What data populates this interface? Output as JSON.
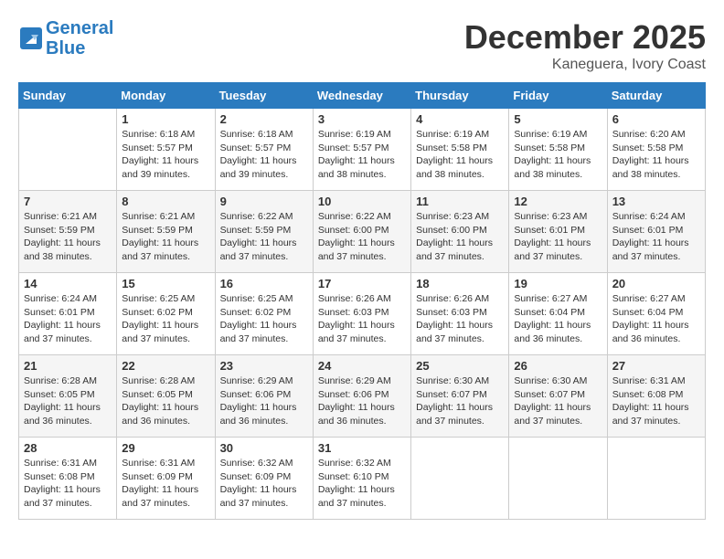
{
  "header": {
    "logo_line1": "General",
    "logo_line2": "Blue",
    "month": "December 2025",
    "location": "Kaneguera, Ivory Coast"
  },
  "weekdays": [
    "Sunday",
    "Monday",
    "Tuesday",
    "Wednesday",
    "Thursday",
    "Friday",
    "Saturday"
  ],
  "weeks": [
    [
      {
        "day": "",
        "sunrise": "",
        "sunset": "",
        "daylight": ""
      },
      {
        "day": "1",
        "sunrise": "Sunrise: 6:18 AM",
        "sunset": "Sunset: 5:57 PM",
        "daylight": "Daylight: 11 hours and 39 minutes."
      },
      {
        "day": "2",
        "sunrise": "Sunrise: 6:18 AM",
        "sunset": "Sunset: 5:57 PM",
        "daylight": "Daylight: 11 hours and 39 minutes."
      },
      {
        "day": "3",
        "sunrise": "Sunrise: 6:19 AM",
        "sunset": "Sunset: 5:57 PM",
        "daylight": "Daylight: 11 hours and 38 minutes."
      },
      {
        "day": "4",
        "sunrise": "Sunrise: 6:19 AM",
        "sunset": "Sunset: 5:58 PM",
        "daylight": "Daylight: 11 hours and 38 minutes."
      },
      {
        "day": "5",
        "sunrise": "Sunrise: 6:19 AM",
        "sunset": "Sunset: 5:58 PM",
        "daylight": "Daylight: 11 hours and 38 minutes."
      },
      {
        "day": "6",
        "sunrise": "Sunrise: 6:20 AM",
        "sunset": "Sunset: 5:58 PM",
        "daylight": "Daylight: 11 hours and 38 minutes."
      }
    ],
    [
      {
        "day": "7",
        "sunrise": "Sunrise: 6:21 AM",
        "sunset": "Sunset: 5:59 PM",
        "daylight": "Daylight: 11 hours and 38 minutes."
      },
      {
        "day": "8",
        "sunrise": "Sunrise: 6:21 AM",
        "sunset": "Sunset: 5:59 PM",
        "daylight": "Daylight: 11 hours and 37 minutes."
      },
      {
        "day": "9",
        "sunrise": "Sunrise: 6:22 AM",
        "sunset": "Sunset: 5:59 PM",
        "daylight": "Daylight: 11 hours and 37 minutes."
      },
      {
        "day": "10",
        "sunrise": "Sunrise: 6:22 AM",
        "sunset": "Sunset: 6:00 PM",
        "daylight": "Daylight: 11 hours and 37 minutes."
      },
      {
        "day": "11",
        "sunrise": "Sunrise: 6:23 AM",
        "sunset": "Sunset: 6:00 PM",
        "daylight": "Daylight: 11 hours and 37 minutes."
      },
      {
        "day": "12",
        "sunrise": "Sunrise: 6:23 AM",
        "sunset": "Sunset: 6:01 PM",
        "daylight": "Daylight: 11 hours and 37 minutes."
      },
      {
        "day": "13",
        "sunrise": "Sunrise: 6:24 AM",
        "sunset": "Sunset: 6:01 PM",
        "daylight": "Daylight: 11 hours and 37 minutes."
      }
    ],
    [
      {
        "day": "14",
        "sunrise": "Sunrise: 6:24 AM",
        "sunset": "Sunset: 6:01 PM",
        "daylight": "Daylight: 11 hours and 37 minutes."
      },
      {
        "day": "15",
        "sunrise": "Sunrise: 6:25 AM",
        "sunset": "Sunset: 6:02 PM",
        "daylight": "Daylight: 11 hours and 37 minutes."
      },
      {
        "day": "16",
        "sunrise": "Sunrise: 6:25 AM",
        "sunset": "Sunset: 6:02 PM",
        "daylight": "Daylight: 11 hours and 37 minutes."
      },
      {
        "day": "17",
        "sunrise": "Sunrise: 6:26 AM",
        "sunset": "Sunset: 6:03 PM",
        "daylight": "Daylight: 11 hours and 37 minutes."
      },
      {
        "day": "18",
        "sunrise": "Sunrise: 6:26 AM",
        "sunset": "Sunset: 6:03 PM",
        "daylight": "Daylight: 11 hours and 37 minutes."
      },
      {
        "day": "19",
        "sunrise": "Sunrise: 6:27 AM",
        "sunset": "Sunset: 6:04 PM",
        "daylight": "Daylight: 11 hours and 36 minutes."
      },
      {
        "day": "20",
        "sunrise": "Sunrise: 6:27 AM",
        "sunset": "Sunset: 6:04 PM",
        "daylight": "Daylight: 11 hours and 36 minutes."
      }
    ],
    [
      {
        "day": "21",
        "sunrise": "Sunrise: 6:28 AM",
        "sunset": "Sunset: 6:05 PM",
        "daylight": "Daylight: 11 hours and 36 minutes."
      },
      {
        "day": "22",
        "sunrise": "Sunrise: 6:28 AM",
        "sunset": "Sunset: 6:05 PM",
        "daylight": "Daylight: 11 hours and 36 minutes."
      },
      {
        "day": "23",
        "sunrise": "Sunrise: 6:29 AM",
        "sunset": "Sunset: 6:06 PM",
        "daylight": "Daylight: 11 hours and 36 minutes."
      },
      {
        "day": "24",
        "sunrise": "Sunrise: 6:29 AM",
        "sunset": "Sunset: 6:06 PM",
        "daylight": "Daylight: 11 hours and 36 minutes."
      },
      {
        "day": "25",
        "sunrise": "Sunrise: 6:30 AM",
        "sunset": "Sunset: 6:07 PM",
        "daylight": "Daylight: 11 hours and 37 minutes."
      },
      {
        "day": "26",
        "sunrise": "Sunrise: 6:30 AM",
        "sunset": "Sunset: 6:07 PM",
        "daylight": "Daylight: 11 hours and 37 minutes."
      },
      {
        "day": "27",
        "sunrise": "Sunrise: 6:31 AM",
        "sunset": "Sunset: 6:08 PM",
        "daylight": "Daylight: 11 hours and 37 minutes."
      }
    ],
    [
      {
        "day": "28",
        "sunrise": "Sunrise: 6:31 AM",
        "sunset": "Sunset: 6:08 PM",
        "daylight": "Daylight: 11 hours and 37 minutes."
      },
      {
        "day": "29",
        "sunrise": "Sunrise: 6:31 AM",
        "sunset": "Sunset: 6:09 PM",
        "daylight": "Daylight: 11 hours and 37 minutes."
      },
      {
        "day": "30",
        "sunrise": "Sunrise: 6:32 AM",
        "sunset": "Sunset: 6:09 PM",
        "daylight": "Daylight: 11 hours and 37 minutes."
      },
      {
        "day": "31",
        "sunrise": "Sunrise: 6:32 AM",
        "sunset": "Sunset: 6:10 PM",
        "daylight": "Daylight: 11 hours and 37 minutes."
      },
      {
        "day": "",
        "sunrise": "",
        "sunset": "",
        "daylight": ""
      },
      {
        "day": "",
        "sunrise": "",
        "sunset": "",
        "daylight": ""
      },
      {
        "day": "",
        "sunrise": "",
        "sunset": "",
        "daylight": ""
      }
    ]
  ]
}
